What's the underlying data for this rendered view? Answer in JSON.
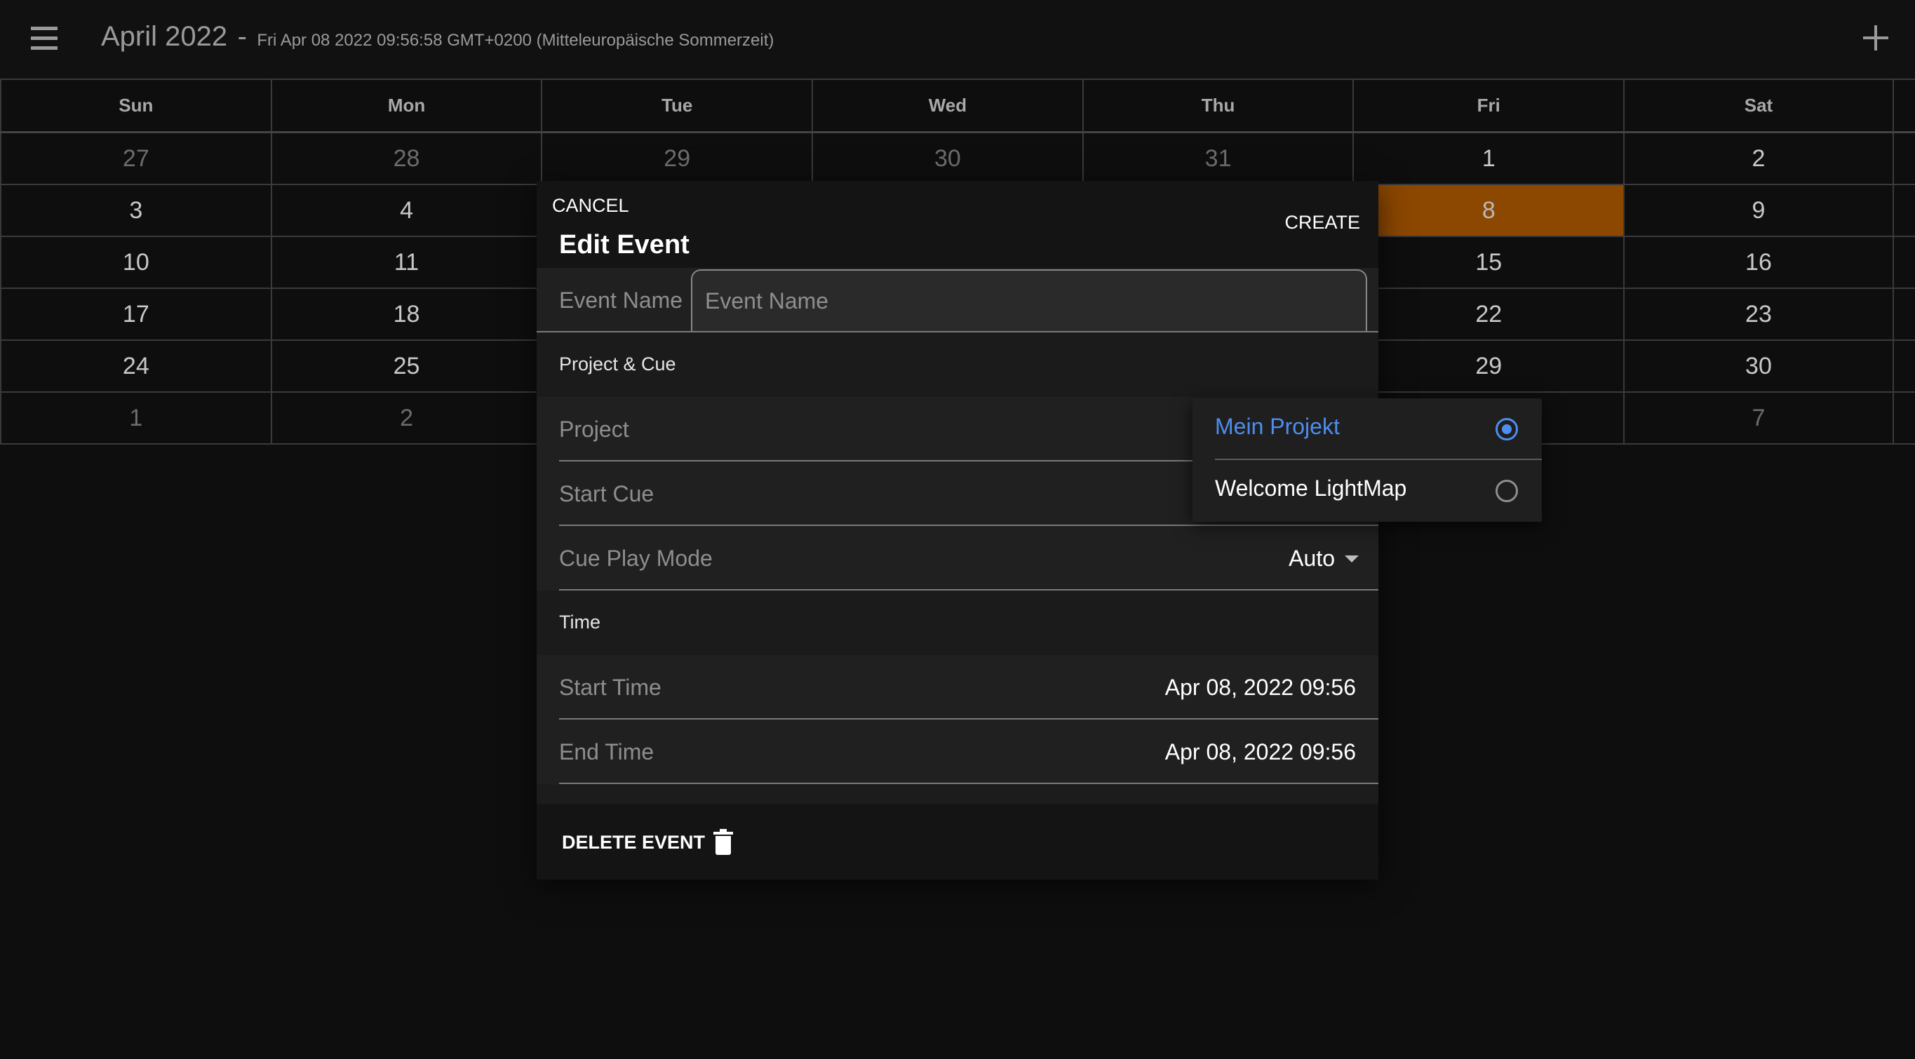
{
  "header": {
    "title": "April 2022",
    "separator": "-",
    "subtitle": "Fri Apr 08 2022 09:56:58 GMT+0200 (Mitteleuropäische Sommerzeit)",
    "menu_icon": "menu-icon",
    "add_icon": "plus-icon"
  },
  "calendar": {
    "weekdays": [
      "Sun",
      "Mon",
      "Tue",
      "Wed",
      "Thu",
      "Fri",
      "Sat"
    ],
    "weeks": [
      [
        "27",
        "28",
        "29",
        "30",
        "31",
        "1",
        "2"
      ],
      [
        "3",
        "4",
        "",
        "",
        "",
        "8",
        "9"
      ],
      [
        "10",
        "11",
        "",
        "",
        "",
        "15",
        "16"
      ],
      [
        "17",
        "18",
        "",
        "",
        "",
        "22",
        "23"
      ],
      [
        "24",
        "25",
        "",
        "",
        "",
        "29",
        "30"
      ],
      [
        "1",
        "2",
        "",
        "",
        "",
        "",
        "7"
      ]
    ],
    "today": "8",
    "today_color": "#8c4700"
  },
  "dialog": {
    "cancel_label": "CANCEL",
    "title": "Edit Event",
    "create_label": "CREATE",
    "event_name_label": "Event Name",
    "event_name_placeholder": "Event Name",
    "event_name_value": "",
    "section_project": "Project & Cue",
    "project_label": "Project",
    "start_cue_label": "Start Cue",
    "cue_play_mode_label": "Cue Play Mode",
    "cue_play_mode_value": "Auto",
    "section_time": "Time",
    "start_time_label": "Start Time",
    "start_time_value": "Apr 08, 2022 09:56",
    "end_time_label": "End Time",
    "end_time_value": "Apr 08, 2022 09:56",
    "delete_label": "DELETE EVENT",
    "delete_icon": "trash-icon"
  },
  "project_dropdown": {
    "options": [
      {
        "label": "Mein Projekt",
        "selected": true
      },
      {
        "label": "Welcome LightMap",
        "selected": false
      }
    ],
    "accent_color": "#4d8ef0"
  }
}
